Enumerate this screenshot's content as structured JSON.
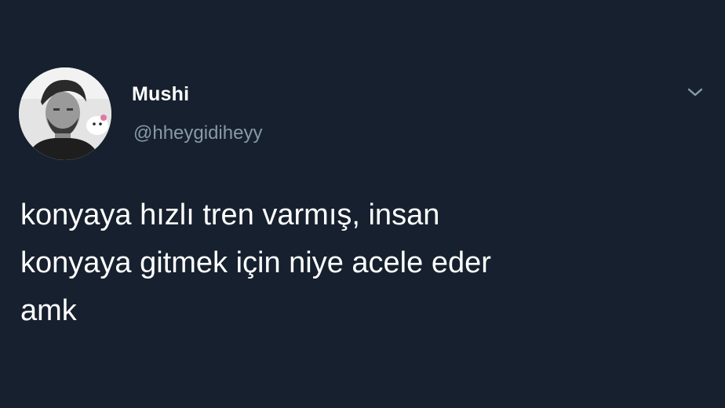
{
  "tweet": {
    "author_name": "Mushi",
    "author_handle": "@hheygidiheyy",
    "text_lines": [
      "konyaya hızlı tren varmış, insan",
      "konyaya gitmek için niye acele eder",
      "amk"
    ],
    "avatar_icon": "profile-photo",
    "menu_icon": "chevron-down-icon"
  },
  "colors": {
    "background": "#16202e",
    "name": "#ffffff",
    "handle": "#8899a6",
    "body_text": "#ffffff",
    "chevron": "#8899a6"
  }
}
